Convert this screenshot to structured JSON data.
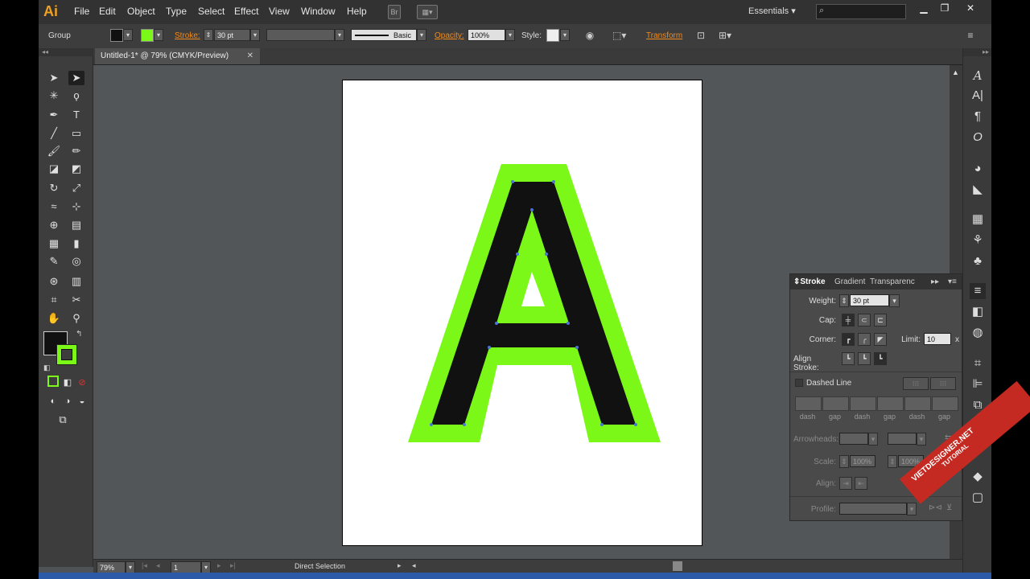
{
  "app": {
    "logo": "Ai"
  },
  "menu": {
    "items": [
      {
        "label": "File"
      },
      {
        "label": "Edit"
      },
      {
        "label": "Object"
      },
      {
        "label": "Type"
      },
      {
        "label": "Select"
      },
      {
        "label": "Effect"
      },
      {
        "label": "View"
      },
      {
        "label": "Window"
      },
      {
        "label": "Help"
      }
    ],
    "br_icon": "Br",
    "workspace": "Essentials"
  },
  "controlbar": {
    "selection_type": "Group",
    "stroke_label": "Stroke:",
    "stroke_weight": "30 pt",
    "brush": "Basic",
    "opacity_label": "Opacity:",
    "opacity_value": "100%",
    "style_label": "Style:",
    "transform_label": "Transform",
    "fill_color": "#111111",
    "stroke_color": "#7cf818"
  },
  "document": {
    "tab_title": "Untitled-1* @ 79% (CMYK/Preview)",
    "letter": "A"
  },
  "stroke_panel": {
    "tabs": [
      "Stroke",
      "Gradient",
      "Transparency"
    ],
    "weight_label": "Weight:",
    "weight_value": "30 pt",
    "cap_label": "Cap:",
    "corner_label": "Corner:",
    "limit_label": "Limit:",
    "limit_value": "10",
    "limit_unit": "x",
    "align_label": "Align Stroke:",
    "dashed_label": "Dashed Line",
    "dash_labels": [
      "dash",
      "gap",
      "dash",
      "gap",
      "dash",
      "gap"
    ],
    "arrowheads_label": "Arrowheads:",
    "scale_label": "Scale:",
    "scale_value_1": "100%",
    "scale_value_2": "100%",
    "align2_label": "Align:",
    "profile_label": "Profile:"
  },
  "statusbar": {
    "zoom": "79%",
    "artboard_number": "1",
    "tool_name": "Direct Selection"
  },
  "watermark": {
    "line1": "VIETDESIGNER.NET",
    "line2": "TUTORIAL"
  }
}
